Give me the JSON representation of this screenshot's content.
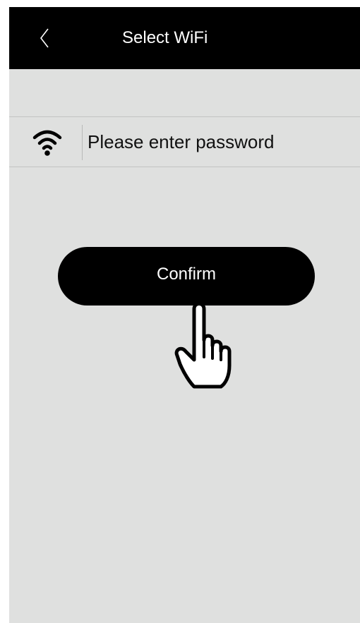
{
  "header": {
    "title": "Select WiFi",
    "back_icon": "chevron-left-icon"
  },
  "wifi_row": {
    "icon": "wifi-icon",
    "placeholder": "Please enter password"
  },
  "actions": {
    "confirm_label": "Confirm"
  },
  "overlay": {
    "icon": "pointing-hand-icon"
  },
  "colors": {
    "header_bg": "#000000",
    "page_bg": "#dfe0df",
    "button_bg": "#000000",
    "button_text": "#ffffff"
  }
}
